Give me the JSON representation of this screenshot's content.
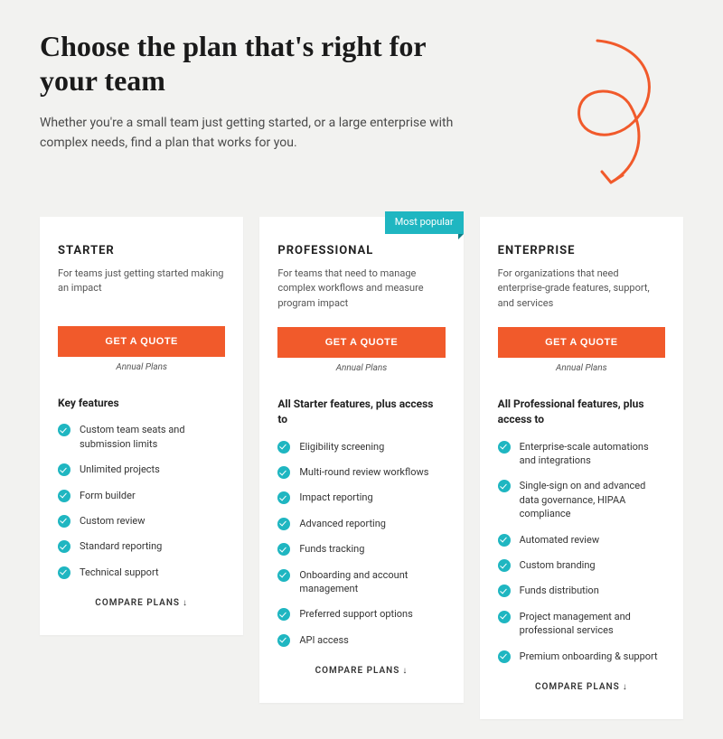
{
  "header": {
    "title": "Choose the plan that's right for your team",
    "subtitle": "Whether you're a small team just getting started, or a large enterprise with complex needs, find a plan that works for you."
  },
  "common": {
    "cta_label": "GET A QUOTE",
    "plan_note": "Annual Plans",
    "compare_label": "COMPARE PLANS"
  },
  "plans": [
    {
      "name": "STARTER",
      "desc": "For teams just getting started making an impact",
      "features_title": "Key features",
      "badge": null,
      "features": [
        "Custom team seats and submission limits",
        "Unlimited projects",
        "Form builder",
        "Custom review",
        "Standard reporting",
        "Technical support"
      ]
    },
    {
      "name": "PROFESSIONAL",
      "desc": "For teams that need to manage complex workflows and measure program impact",
      "features_title": "All Starter features, plus access to",
      "badge": "Most popular",
      "features": [
        "Eligibility screening",
        "Multi-round review workflows",
        "Impact reporting",
        "Advanced reporting",
        "Funds tracking",
        "Onboarding and account management",
        "Preferred support options",
        "API access"
      ]
    },
    {
      "name": "ENTERPRISE",
      "desc": "For organizations that need enterprise-grade features, support, and services",
      "features_title": "All Professional features, plus access to",
      "badge": null,
      "features": [
        "Enterprise-scale automations and integrations",
        "Single-sign on and advanced data governance, HIPAA compliance",
        "Automated review",
        "Custom branding",
        "Funds distribution",
        "Project management and professional services",
        "Premium onboarding & support"
      ]
    }
  ]
}
